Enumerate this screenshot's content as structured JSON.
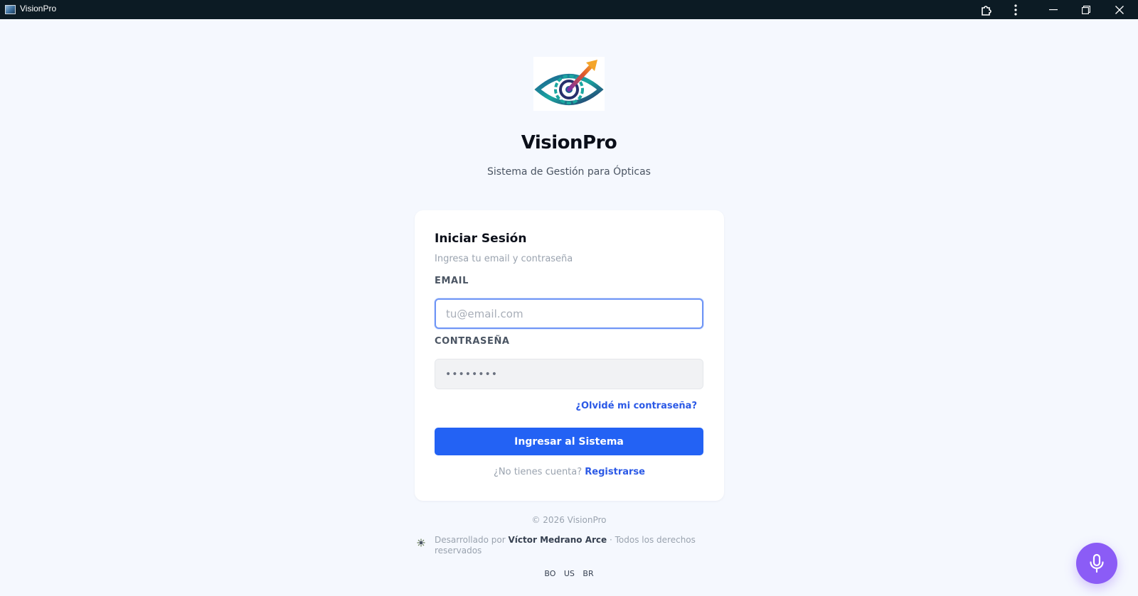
{
  "window": {
    "title": "VisionPro",
    "icons": [
      "app-icon",
      "extensions-icon",
      "more-vertical-icon",
      "minimize-icon",
      "restore-icon",
      "close-icon"
    ]
  },
  "brand": {
    "name": "VisionPro",
    "subtitle": "Sistema de Gestión para Ópticas",
    "logo_icon": "eye-target-arrow-logo"
  },
  "login": {
    "title": "Iniciar Sesión",
    "subtitle": "Ingresa tu email y contraseña",
    "email_label": "EMAIL",
    "email_placeholder": "tu@email.com",
    "email_value": "",
    "password_label": "CONTRASEÑA",
    "password_placeholder": "••••••••",
    "forgot_link": "¿Olvidé mi contraseña?",
    "submit_label": "Ingresar al Sistema",
    "no_account_text": "¿No tienes cuenta?",
    "register_link": "Registrarse"
  },
  "footer": {
    "copyright": "© 2026 VisionPro",
    "developed_by": "Desarrollado por",
    "developer_name": "Víctor Medrano Arce",
    "rights": "· Todos los derechos reservados",
    "languages": [
      "BO",
      "US",
      "BR"
    ]
  },
  "colors": {
    "accent": "#2362f4",
    "link": "#2b59e6",
    "mic_button": "#8b5cf6",
    "titlebar": "#0c1b24",
    "background": "#f5f8fe"
  }
}
